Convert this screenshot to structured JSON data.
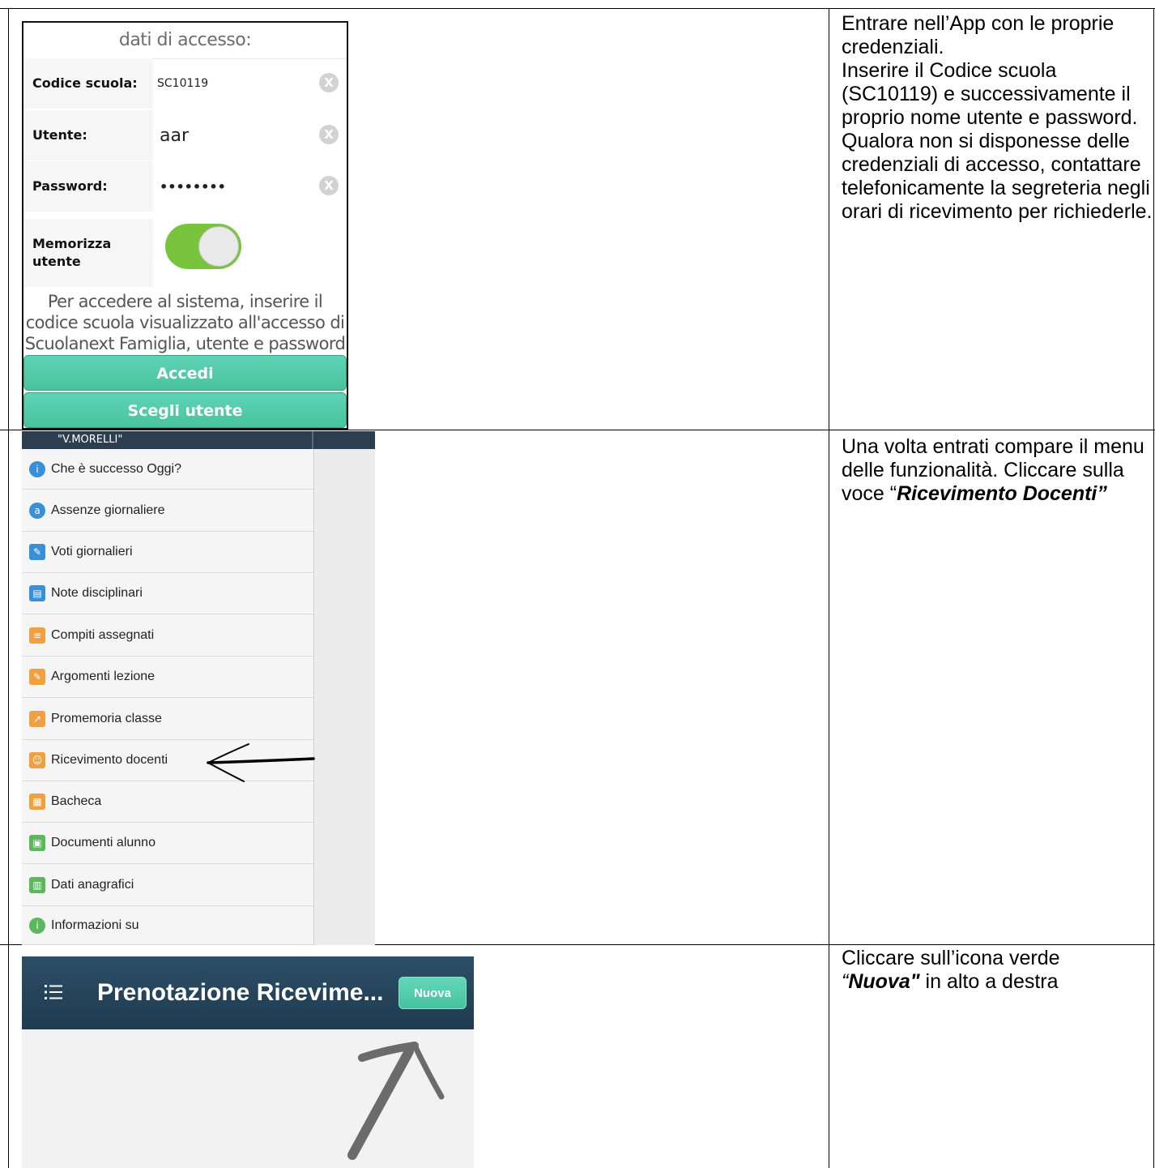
{
  "login": {
    "header": "dati di accesso:",
    "rows": [
      {
        "label": "Codice scuola:",
        "value": "SC10119"
      },
      {
        "label": "Utente:",
        "value": "aar"
      },
      {
        "label": "Password:",
        "value": "••••••••"
      },
      {
        "label": "Memorizza utente",
        "value": ""
      }
    ],
    "clear_glyph": "X",
    "remember_toggle_on": true,
    "help_text": "Per accedere al sistema, inserire il codice scuola visualizzato all'accesso di Scuolanext Famiglia, utente e password",
    "login_button": "Accedi",
    "choose_user_button": "Scegli utente",
    "accent_color": "#78c43c",
    "button_color": "#48c49c"
  },
  "menu": {
    "school_name": "\"V.MORELLI\"",
    "items": [
      {
        "label": "Che è successo Oggi?",
        "icon": "info-icon",
        "color": "#3a8fd9"
      },
      {
        "label": "Assenze giornaliere",
        "icon": "absence-icon",
        "color": "#3a8fd9"
      },
      {
        "label": "Voti giornalieri",
        "icon": "grades-icon",
        "color": "#3a8fd9"
      },
      {
        "label": "Note disciplinari",
        "icon": "notes-icon",
        "color": "#3a8fd9"
      },
      {
        "label": "Compiti assegnati",
        "icon": "homework-icon",
        "color": "#f0a040"
      },
      {
        "label": "Argomenti lezione",
        "icon": "lesson-icon",
        "color": "#f0a040"
      },
      {
        "label": "Promemoria classe",
        "icon": "reminder-icon",
        "color": "#f0a040"
      },
      {
        "label": "Ricevimento docenti",
        "icon": "meeting-icon",
        "color": "#f0a040"
      },
      {
        "label": "Bacheca",
        "icon": "board-icon",
        "color": "#f0a040"
      },
      {
        "label": "Documenti alunno",
        "icon": "documents-icon",
        "color": "#5cb85c"
      },
      {
        "label": "Dati anagrafici",
        "icon": "personal-data-icon",
        "color": "#5cb85c"
      },
      {
        "label": "Informazioni su",
        "icon": "about-icon",
        "color": "#5cb85c"
      }
    ]
  },
  "prenotazione": {
    "title": "Prenotazione Ricevime...",
    "new_button": "Nuova",
    "bar_color": "#1f3b50"
  },
  "instructions": {
    "step1": [
      "Entrare nell’App con le proprie credenziali.",
      "Inserire il Codice scuola (SC10119) e successivamente il proprio nome utente e password.",
      "Qualora non si disponesse delle credenziali di accesso, contattare telefonicamente la segreteria negli orari di ricevimento per richiederle."
    ],
    "step2_text": "Una volta entrati compare il menu delle funzionalità. Cliccare sulla voce ",
    "step2_open_quote": "“",
    "step2_emph": "Ricevimento Docenti”",
    "step3_open_quote": "“",
    "step3_emph": "Nuova\"",
    "step3_text": " in alto a destra",
    "step3_lead": "Cliccare sull’icona verde"
  }
}
